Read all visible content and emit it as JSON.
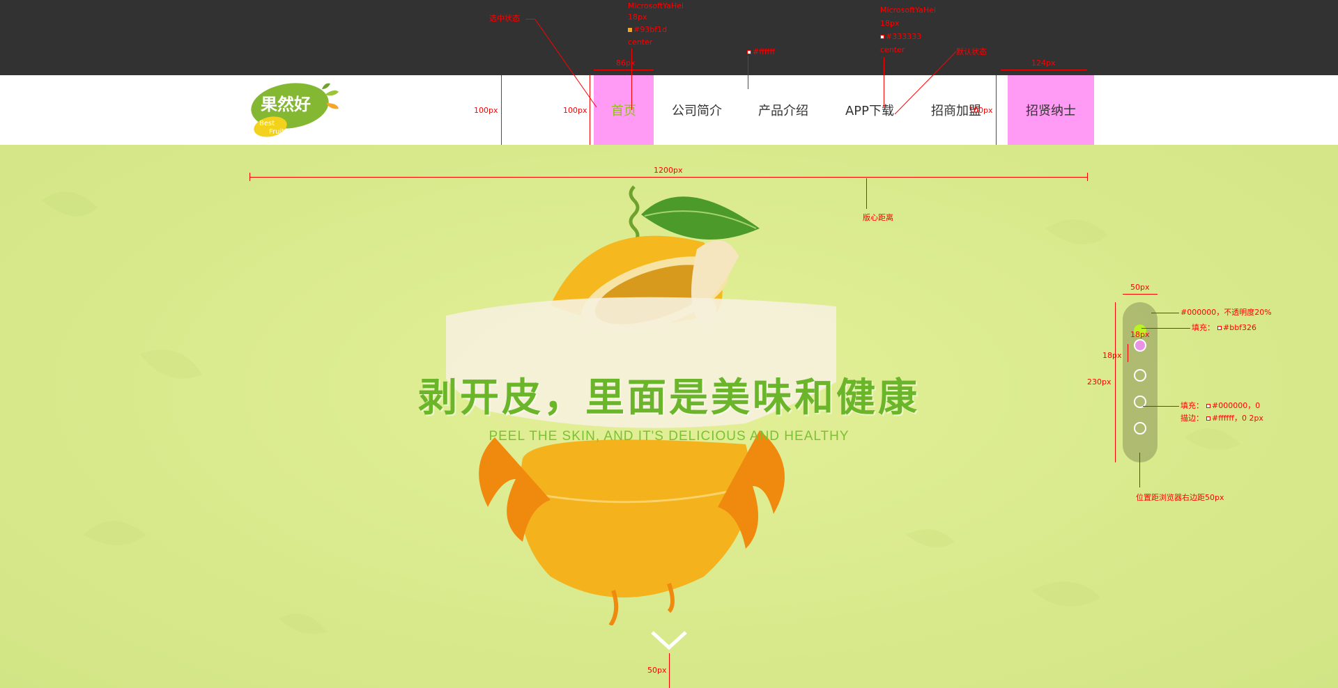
{
  "brand": {
    "logo_cn": "果然好",
    "logo_en1": "Best",
    "logo_en2": "Fruit"
  },
  "nav": {
    "items": [
      {
        "label": "首页",
        "state": "active"
      },
      {
        "label": "公司简介",
        "state": "default"
      },
      {
        "label": "产品介绍",
        "state": "default"
      },
      {
        "label": "APP下载",
        "state": "default"
      },
      {
        "label": "招商加盟",
        "state": "default"
      },
      {
        "label": "招贤纳士",
        "state": "cta"
      }
    ]
  },
  "hero": {
    "headline": "剥开皮，里面是美味和健康",
    "subline": "PEEL THE SKIN, AND IT'S DELICIOUS AND HEALTHY"
  },
  "slider": {
    "count": 5,
    "active_index": 0
  },
  "annotations": {
    "selected_state": "选中状态",
    "default_state": "默认状态",
    "active_font": "MicrosoftYaHei",
    "active_size": "18px",
    "active_color": "#93bf1d",
    "active_align": "center",
    "default_font": "MicrosoftYaHei",
    "default_size": "18px",
    "default_color": "#333333",
    "default_align": "center",
    "header_bg": "#ffffff",
    "w86": "86px",
    "w124": "124px",
    "h100a": "100px",
    "h100b": "100px",
    "h100c": "100px",
    "w1200": "1200px",
    "center_margin": "版心距离",
    "w50": "50px",
    "slider_bg": "#000000，不透明度20%",
    "fill_active": "填充：",
    "fill_active_color": "#bbf326",
    "w18": "18px",
    "h18": "18px",
    "h230": "230px",
    "fill_default": "填充：",
    "fill_default_value": "#000000，0",
    "stroke_default": "描边：",
    "stroke_default_value": "#ffffff，0   2px",
    "right_offset": "位置距浏览器右边距50px",
    "bottom50": "50px"
  },
  "colors": {
    "header_bg": "#ffffff",
    "topband": "#323232",
    "active_text": "#93bf1d",
    "default_text": "#333333",
    "highlight": "#ff9af5",
    "hero_bg": "#dbe98f",
    "headline": "#6ab52a",
    "dot_active": "#bbf326",
    "annotation": "#ff0000"
  }
}
